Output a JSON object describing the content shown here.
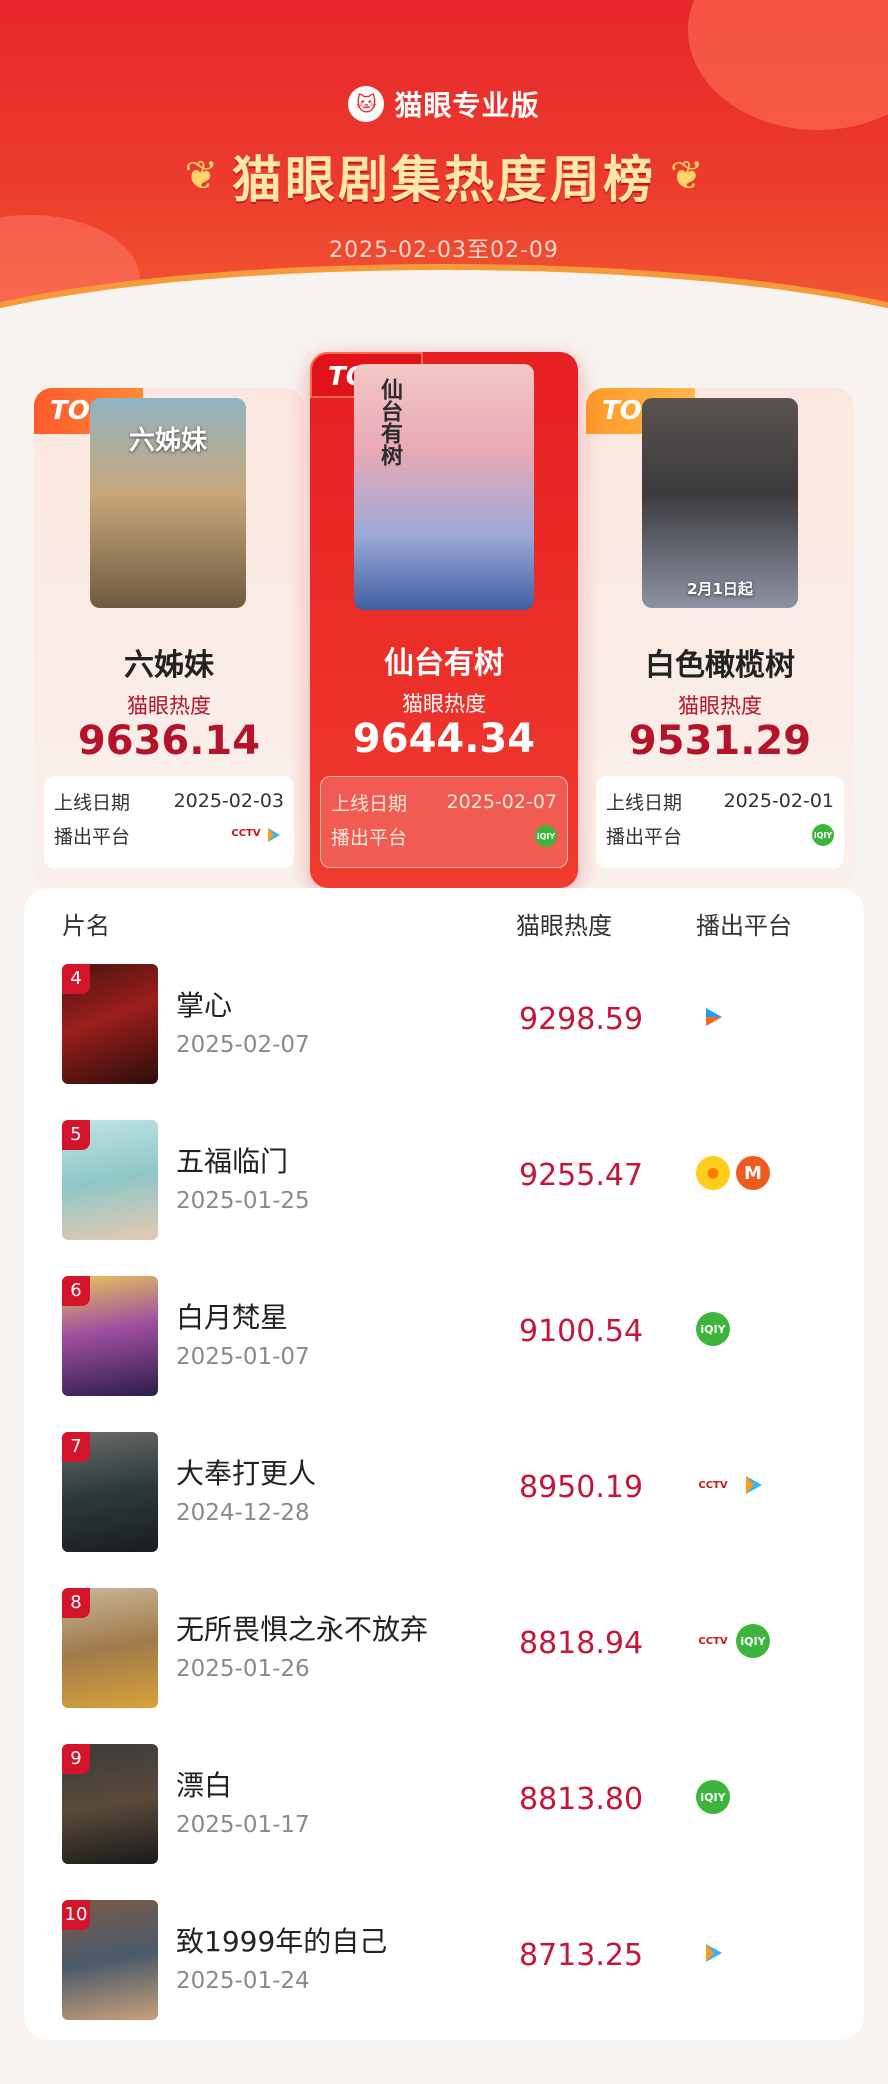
{
  "header": {
    "brand_logo": "🐱",
    "brand": "猫眼专业版",
    "title": "猫眼剧集热度周榜",
    "laurel_left": "❦",
    "laurel_right": "❦",
    "date_range": "2025-02-03至02-09"
  },
  "top3": [
    {
      "rank_label": "TOP1",
      "title": "仙台有树",
      "poster_text": "仙台有树",
      "heat_label": "猫眼热度",
      "heat": "9644.34",
      "release_label": "上线日期",
      "release_date": "2025-02-07",
      "platform_label": "播出平台",
      "platforms": [
        "iqiyi"
      ]
    },
    {
      "rank_label": "TOP2",
      "title": "六姊妹",
      "poster_text": "六姊妹",
      "heat_label": "猫眼热度",
      "heat": "9636.14",
      "release_label": "上线日期",
      "release_date": "2025-02-03",
      "platform_label": "播出平台",
      "platforms": [
        "cctv",
        "tencent"
      ]
    },
    {
      "rank_label": "TOP3",
      "title": "白色橄榄树",
      "poster_text": "2月1日起",
      "heat_label": "猫眼热度",
      "heat": "9531.29",
      "release_label": "上线日期",
      "release_date": "2025-02-01",
      "platform_label": "播出平台",
      "platforms": [
        "iqiyi"
      ]
    }
  ],
  "list": {
    "col_title": "片名",
    "col_heat": "猫眼热度",
    "col_platform": "播出平台",
    "rows": [
      {
        "rank": "4",
        "title": "掌心",
        "date": "2025-02-07",
        "heat": "9298.59",
        "platforms": [
          "youku"
        ]
      },
      {
        "rank": "5",
        "title": "五福临门",
        "date": "2025-01-25",
        "heat": "9255.47",
        "platforms": [
          "yingshi",
          "mgtv"
        ]
      },
      {
        "rank": "6",
        "title": "白月梵星",
        "date": "2025-01-07",
        "heat": "9100.54",
        "platforms": [
          "iqiyi"
        ]
      },
      {
        "rank": "7",
        "title": "大奉打更人",
        "date": "2024-12-28",
        "heat": "8950.19",
        "platforms": [
          "cctv",
          "tencent"
        ]
      },
      {
        "rank": "8",
        "title": "无所畏惧之永不放弃",
        "date": "2025-01-26",
        "heat": "8818.94",
        "platforms": [
          "cctv",
          "iqiyi"
        ]
      },
      {
        "rank": "9",
        "title": "漂白",
        "date": "2025-01-17",
        "heat": "8813.80",
        "platforms": [
          "iqiyi"
        ]
      },
      {
        "rank": "10",
        "title": "致1999年的自己",
        "date": "2025-01-24",
        "heat": "8713.25",
        "platforms": [
          "tencent"
        ]
      }
    ]
  },
  "colors": {
    "primary_red": "#e8262b",
    "heat_red": "#c4163a",
    "gold": "#ffe7a8"
  }
}
